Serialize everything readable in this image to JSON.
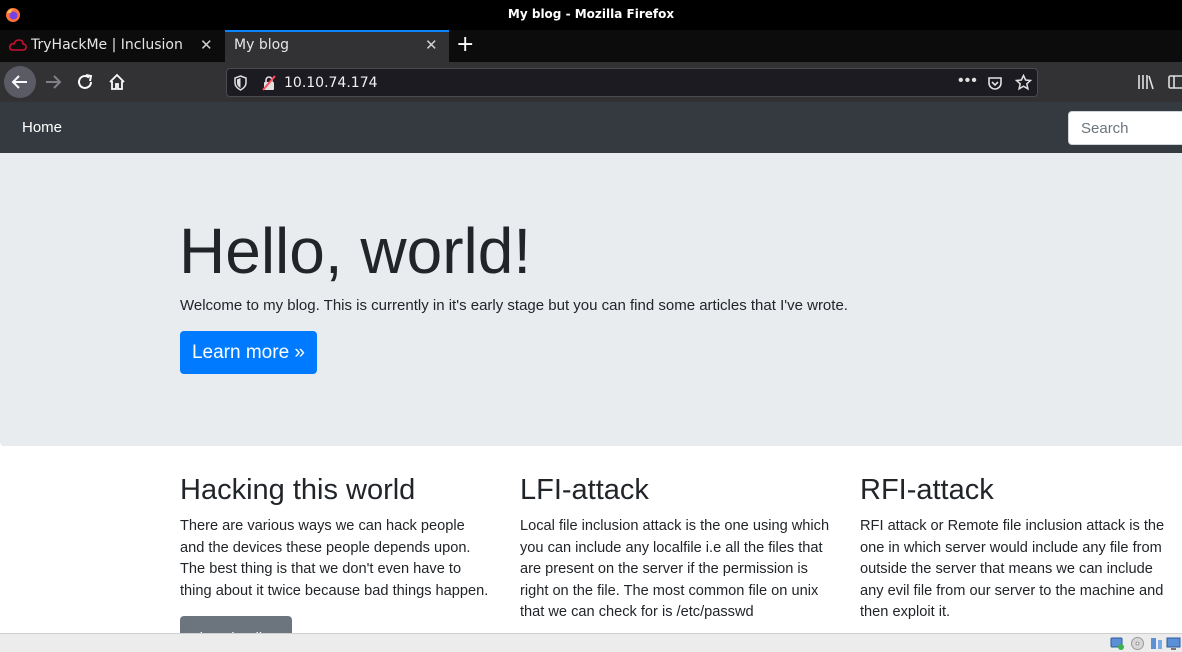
{
  "window": {
    "title": "My blog - Mozilla Firefox"
  },
  "tabs": [
    {
      "label": "TryHackMe | Inclusion",
      "active": false,
      "icon": "tryhackme-cloud-icon"
    },
    {
      "label": "My blog",
      "active": true
    }
  ],
  "urlbar": {
    "url": "10.10.74.174",
    "more": "•••"
  },
  "site": {
    "nav": {
      "home": "Home",
      "search_placeholder": "Search"
    },
    "jumbotron": {
      "heading": "Hello, world!",
      "text": "Welcome to my blog. This is currently in it's early stage but you can find some articles that I've wrote.",
      "button": "Learn more »"
    },
    "articles": [
      {
        "title": "Hacking this world",
        "body": "There are various ways we can hack people and the devices these people depends upon. The best thing is that we don't even have to thing about it twice because bad things happen.",
        "button": "View details »"
      },
      {
        "title": "LFI-attack",
        "body": "Local file inclusion attack is the one using which you can include any localfile i.e all the files that are present on the server if the permission is right on the file. The most common file on unix that we can check for is /etc/passwd"
      },
      {
        "title": "RFI-attack",
        "body": "RFI attack or Remote file inclusion attack is the one in which server would include any file from outside the server that means we can include any evil file from our server to the machine and then exploit it."
      }
    ]
  },
  "colors": {
    "accent": "#0a84ff",
    "primary_button": "#007bff",
    "secondary_button": "#6c757d",
    "site_nav": "#343a40",
    "jumbotron": "#e9ecef"
  }
}
